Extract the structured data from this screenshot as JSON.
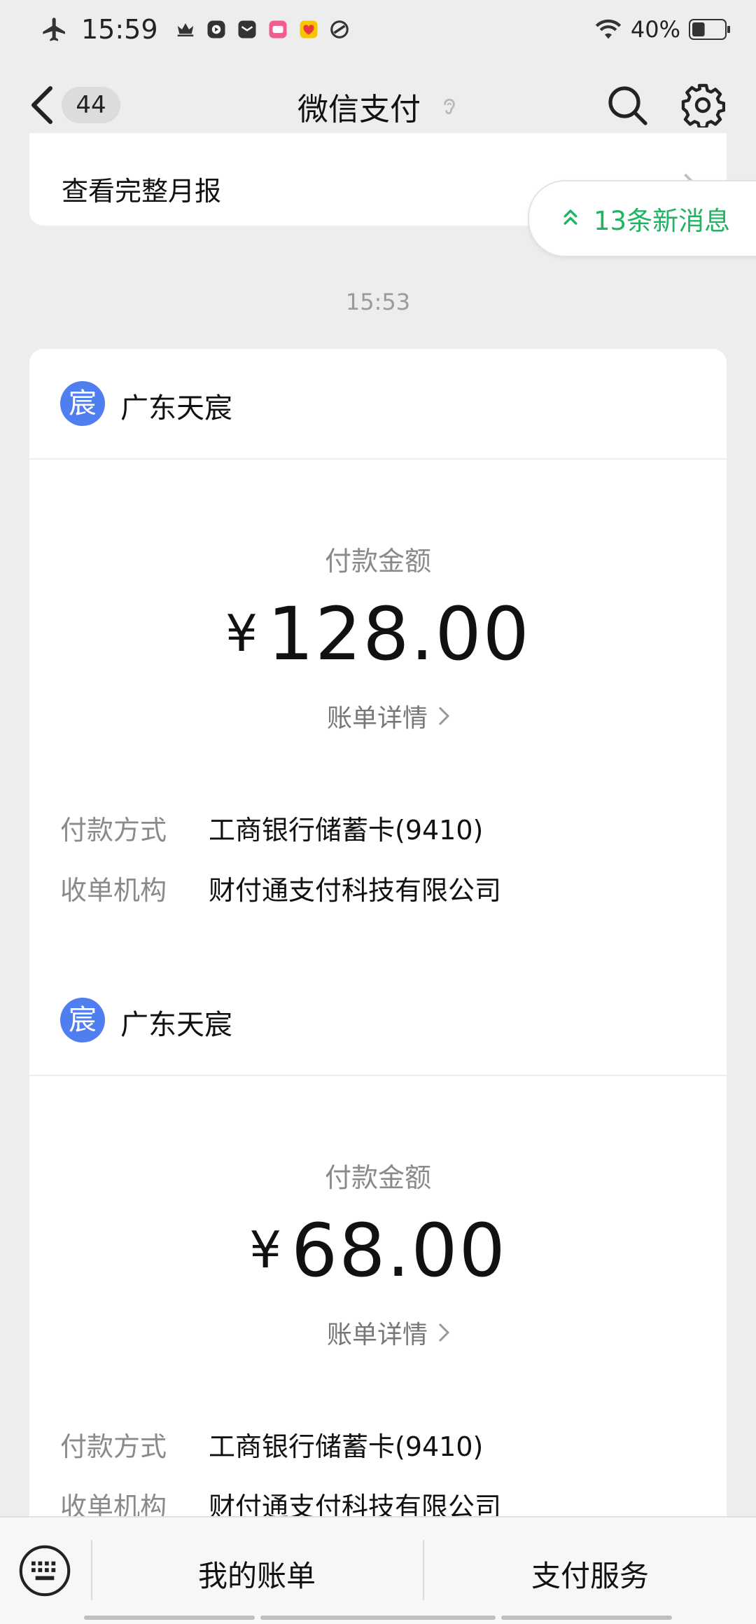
{
  "status_bar": {
    "time": "15:59",
    "battery_text": "40%",
    "battery_level": 0.4
  },
  "nav": {
    "back_count": "44",
    "title": "微信支付"
  },
  "report": {
    "label": "查看完整月报"
  },
  "new_messages": {
    "label": "13条新消息"
  },
  "timestamp": "15:53",
  "payments": [
    {
      "merchant": "广东天宸",
      "logo_char": "宸",
      "amount_label": "付款金额",
      "currency": "¥",
      "amount": "128.00",
      "detail_link": "账单详情",
      "method_label": "付款方式",
      "method_value": "工商银行储蓄卡(9410)",
      "acquirer_label": "收单机构",
      "acquirer_value": "财付通支付科技有限公司"
    },
    {
      "merchant": "广东天宸",
      "logo_char": "宸",
      "amount_label": "付款金额",
      "currency": "¥",
      "amount": "68.00",
      "detail_link": "账单详情",
      "method_label": "付款方式",
      "method_value": "工商银行储蓄卡(9410)",
      "acquirer_label": "收单机构",
      "acquirer_value": "财付通支付科技有限公司"
    }
  ],
  "bottom_menu": {
    "my_bills": "我的账单",
    "pay_services": "支付服务"
  },
  "colors": {
    "accent_green": "#20b361",
    "merchant_logo_blue": "#4f7ef0",
    "background": "#ededed"
  },
  "icons": {
    "back": "chevron-left-icon",
    "search": "search-icon",
    "settings": "gear-icon",
    "ear": "ear-icon",
    "keyboard": "keyboard-icon"
  }
}
